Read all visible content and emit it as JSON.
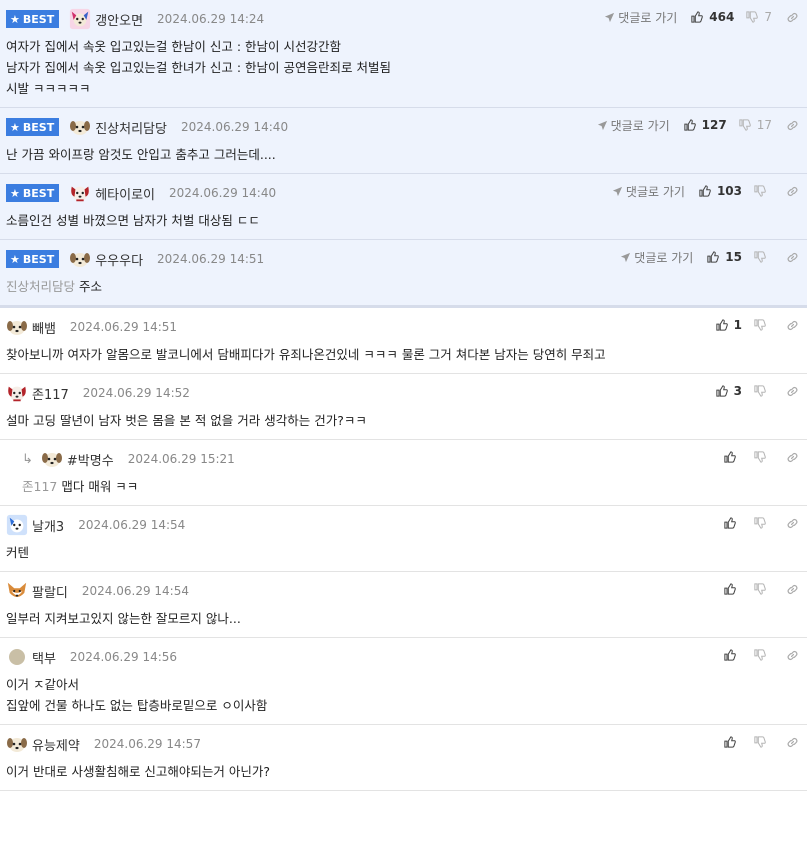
{
  "labels": {
    "best": "BEST",
    "goto": "댓글로 가기"
  },
  "colors": {
    "best_bg": "#eef3fd",
    "badge": "#3b7de0"
  },
  "comments": [
    {
      "best": true,
      "avatar_icon": "dog-with-pink-ears-icon",
      "nick": "갱안오면",
      "date": "2024.06.29 14:24",
      "likes": "464",
      "dislikes": "7",
      "text": "여자가 집에서 속옷 입고있는걸 한남이 신고 : 한남이 시선강간함\n남자가 집에서 속옷 입고있는걸 한녀가 신고 : 한남이 공연음란죄로 처벌됨\n시발 ㅋㅋㅋㅋㅋ"
    },
    {
      "best": true,
      "avatar_icon": "puppy-icon",
      "nick": "진상처리담당",
      "date": "2024.06.29 14:40",
      "likes": "127",
      "dislikes": "17",
      "text": "난 가끔 와이프랑 암것도 안입고 춤추고 그러는데...."
    },
    {
      "best": true,
      "avatar_icon": "red-dog-icon",
      "nick": "헤타이로이",
      "date": "2024.06.29 14:40",
      "likes": "103",
      "dislikes": "",
      "text": "소름인건 성별 바꼈으면 남자가 처벌 대상됨 ㄷㄷ"
    },
    {
      "best": true,
      "avatar_icon": "puppy-icon",
      "nick": "우우우다",
      "date": "2024.06.29 14:51",
      "likes": "15",
      "dislikes": "",
      "mention": "진상처리담당",
      "text": "주소"
    },
    {
      "best": false,
      "avatar_icon": "puppy-icon",
      "nick": "빼뱀",
      "date": "2024.06.29 14:51",
      "likes": "1",
      "dislikes": "",
      "text": "찾아보니까 여자가 알몸으로 발코니에서 담배피다가 유죄나온건있네 ㅋㅋㅋ 물론 그거 쳐다본 남자는 당연히 무죄고"
    },
    {
      "best": false,
      "avatar_icon": "red-dog-icon",
      "nick": "존117",
      "date": "2024.06.29 14:52",
      "likes": "3",
      "dislikes": "",
      "text": "설마 고딩 딸년이 남자 벗은 몸을 본 적 없을 거라 생각하는 건가?ㅋㅋ"
    },
    {
      "best": false,
      "reply": true,
      "avatar_icon": "puppy-icon",
      "nick": "#박명수",
      "date": "2024.06.29 15:21",
      "likes": "",
      "dislikes": "",
      "mention": "존117",
      "text": "맵다 매워 ㅋㅋ"
    },
    {
      "best": false,
      "avatar_icon": "blue-dog-icon",
      "nick": "날개3",
      "date": "2024.06.29 14:54",
      "likes": "",
      "dislikes": "",
      "text": "커텐"
    },
    {
      "best": false,
      "avatar_icon": "fox-icon",
      "nick": "팔랄디",
      "date": "2024.06.29 14:54",
      "likes": "",
      "dislikes": "",
      "text": "일부러 지켜보고있지 않는한 잘모르지 않나..."
    },
    {
      "best": false,
      "avatar_icon": "grey-circle-avatar-icon",
      "nick": "택부",
      "date": "2024.06.29 14:56",
      "likes": "",
      "dislikes": "",
      "text": "이거 ㅈ같아서\n집앞에 건물 하나도 없는 탑층바로밑으로 ㅇ이사함"
    },
    {
      "best": false,
      "avatar_icon": "puppy-icon",
      "nick": "유능제약",
      "date": "2024.06.29 14:57",
      "likes": "",
      "dislikes": "",
      "text": "이거 반대로 사생활침해로 신고해야되는거 아닌가?"
    }
  ]
}
